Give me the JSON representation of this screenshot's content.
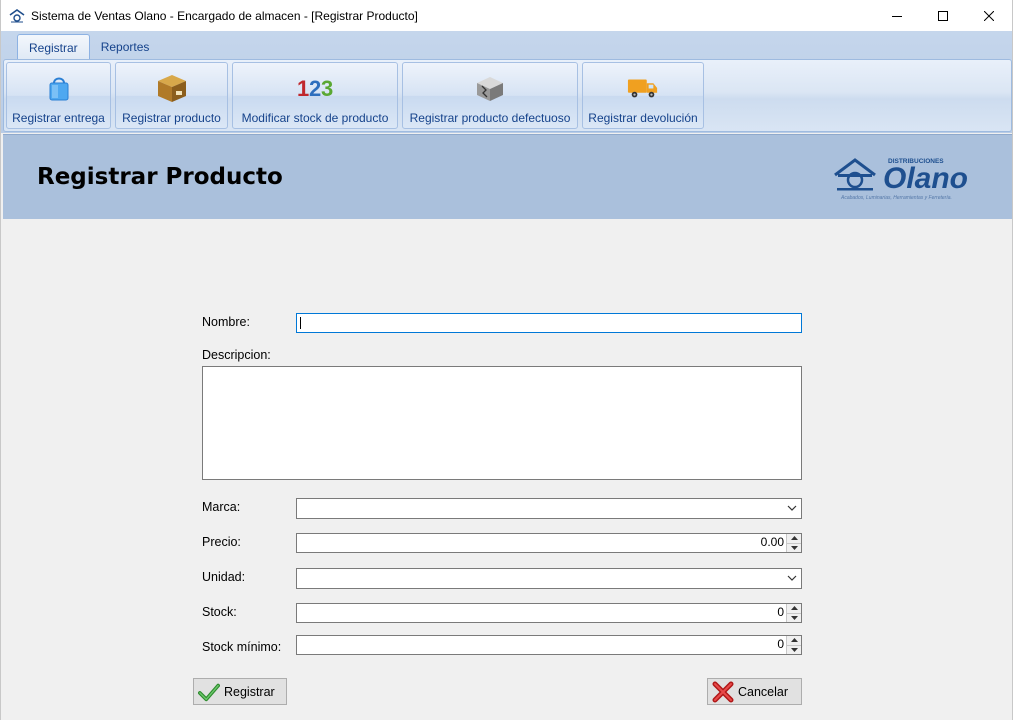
{
  "window": {
    "title": "Sistema de Ventas Olano - Encargado de almacen - [Registrar Producto]",
    "controls": {
      "minimize": "─",
      "maximize": "☐",
      "close": "✕"
    }
  },
  "ribbon": {
    "tabs": [
      {
        "label": "Registrar",
        "active": true
      },
      {
        "label": "Reportes",
        "active": false
      }
    ],
    "buttons": [
      {
        "label": "Registrar entrega",
        "icon": "shopping-bag-icon"
      },
      {
        "label": "Registrar producto",
        "icon": "box-icon"
      },
      {
        "label": "Modificar stock de producto",
        "icon": "numbers-123-icon"
      },
      {
        "label": "Registrar producto defectuoso",
        "icon": "damaged-box-icon"
      },
      {
        "label": "Registrar devolución",
        "icon": "delivery-truck-icon"
      }
    ]
  },
  "header": {
    "title": "Registrar Producto",
    "logo": {
      "top_text": "DISTRIBUCIONES",
      "brand": "Olano",
      "tagline": "Acabados, Luminarias, Herramientas y Ferretería."
    }
  },
  "form": {
    "nombre": {
      "label": "Nombre:",
      "value": ""
    },
    "descripcion": {
      "label": "Descripcion:",
      "value": ""
    },
    "marca": {
      "label": "Marca:",
      "value": ""
    },
    "precio": {
      "label": "Precio:",
      "value": "0.00"
    },
    "unidad": {
      "label": "Unidad:",
      "value": ""
    },
    "stock": {
      "label": "Stock:",
      "value": "0"
    },
    "stock_minimo": {
      "label": "Stock mínimo:",
      "value": "0"
    }
  },
  "actions": {
    "register_label": "Registrar",
    "cancel_label": "Cancelar"
  },
  "colors": {
    "ribbon_text": "#15428b",
    "header_band": "#aac0dc",
    "focus_border": "#0078d7"
  }
}
